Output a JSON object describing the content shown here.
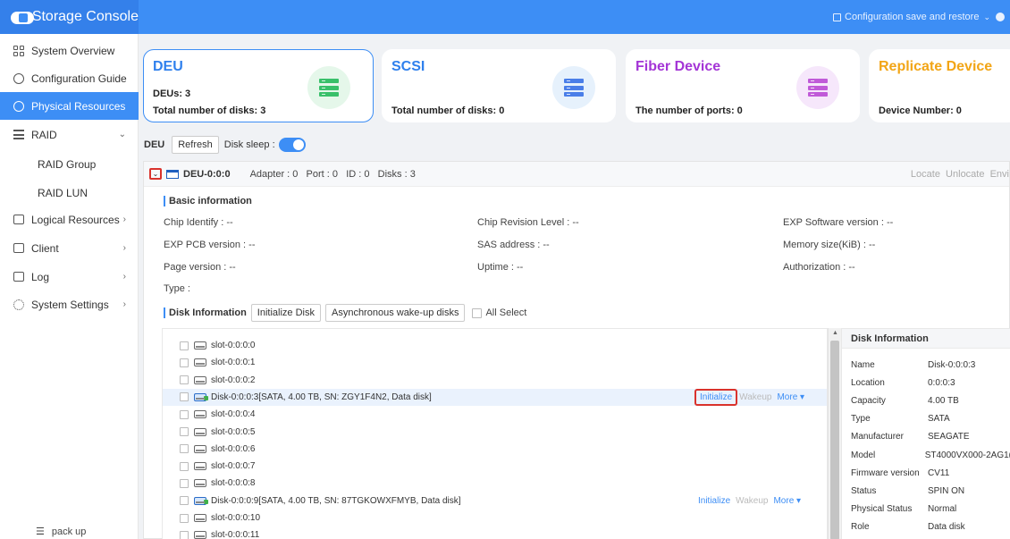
{
  "app": {
    "title": "Storage Console",
    "config_link": "Configuration save and restore",
    "accent": "#3d8ef5"
  },
  "sidebar": {
    "items": [
      {
        "label": "System Overview",
        "icon": "grid-icon"
      },
      {
        "label": "Configuration Guide",
        "icon": "guide-icon"
      },
      {
        "label": "Physical Resources",
        "icon": "physical-icon",
        "active": true
      },
      {
        "label": "RAID",
        "icon": "raid-icon",
        "arrow": "⌄"
      },
      {
        "label": "RAID Group",
        "sub": true
      },
      {
        "label": "RAID LUN",
        "sub": true
      },
      {
        "label": "Logical Resources",
        "icon": "logical-icon",
        "arrow": "›"
      },
      {
        "label": "Client",
        "icon": "client-icon",
        "arrow": "›"
      },
      {
        "label": "Log",
        "icon": "log-icon",
        "arrow": "›"
      },
      {
        "label": "System Settings",
        "icon": "settings-icon",
        "arrow": "›"
      }
    ],
    "pack_up": "pack up"
  },
  "cards": [
    {
      "title": "DEU",
      "title_color": "#2f80ed",
      "line1": "DEUs: 3",
      "line2": "Total number of disks: 3",
      "icon_bg": "#e5f7ea",
      "icon_color": "#39c06a"
    },
    {
      "title": "SCSI",
      "title_color": "#2f80ed",
      "line1": "",
      "line2": "Total number of disks: 0",
      "icon_bg": "#e6f1fc",
      "icon_color": "#4a7ee8"
    },
    {
      "title": "Fiber Device",
      "title_color": "#a435d6",
      "line1": "",
      "line2": "The number of ports: 0",
      "icon_bg": "#f6e7fb",
      "icon_color": "#c05ad8"
    },
    {
      "title": "Replicate Device",
      "title_color": "#f2a516",
      "line1": "",
      "line2": "Device Number: 0",
      "icon_bg": "#fff4e0",
      "icon_color": "#f2a516"
    }
  ],
  "toolbar": {
    "label": "DEU",
    "refresh": "Refresh",
    "disk_sleep": "Disk sleep :",
    "disk_sleep_on": true
  },
  "enclosure": {
    "name": "DEU-0:0:0",
    "meta": "Adapter : 0   Port : 0   ID : 0   Disks : 3",
    "actions": "Locate  Unlocate  Envi"
  },
  "basic": {
    "title": "Basic information",
    "fields": [
      "Chip Identify : --",
      "Chip Revision Level : --",
      "EXP Software version : --",
      "EXP PCB version : --",
      "SAS address : --",
      "Memory size(KiB) : --",
      "Page version : --",
      "Uptime : --",
      "Authorization : --",
      "Type :"
    ]
  },
  "disk_section": {
    "title": "Disk Information",
    "initialize_disk": "Initialize Disk",
    "async_wakeup": "Asynchronous wake-up disks",
    "all_select": "All Select"
  },
  "disks": [
    {
      "label": "slot-0:0:0:0"
    },
    {
      "label": "slot-0:0:0:1"
    },
    {
      "label": "slot-0:0:0:2"
    },
    {
      "label": "Disk-0:0:0:3[SATA, 4.00 TB, SN: ZGY1F4N2, Data disk]",
      "disk": true,
      "selected": true,
      "highlight": true
    },
    {
      "label": "slot-0:0:0:4"
    },
    {
      "label": "slot-0:0:0:5"
    },
    {
      "label": "slot-0:0:0:6"
    },
    {
      "label": "slot-0:0:0:7"
    },
    {
      "label": "slot-0:0:0:8"
    },
    {
      "label": "Disk-0:0:0:9[SATA, 4.00 TB, SN: 87TGKOWXFMYB, Data disk]",
      "disk": true
    },
    {
      "label": "slot-0:0:0:10"
    },
    {
      "label": "slot-0:0:0:11"
    }
  ],
  "row_actions": {
    "initialize": "Initialize",
    "wakeup": "Wakeup",
    "more": "More ▾"
  },
  "disk_info": {
    "title": "Disk Information",
    "rows": [
      {
        "k": "Name",
        "v": "Disk-0:0:0:3"
      },
      {
        "k": "Location",
        "v": "0:0:0:3"
      },
      {
        "k": "Capacity",
        "v": "4.00 TB"
      },
      {
        "k": "Type",
        "v": "SATA"
      },
      {
        "k": "Manufacturer",
        "v": "SEAGATE"
      },
      {
        "k": "Model",
        "v": "ST4000VX000-2AG1("
      },
      {
        "k": "Firmware version",
        "v": "CV11"
      },
      {
        "k": "Status",
        "v": "SPIN ON"
      },
      {
        "k": "Physical Status",
        "v": "Normal"
      },
      {
        "k": "Role",
        "v": "Data disk"
      }
    ]
  }
}
